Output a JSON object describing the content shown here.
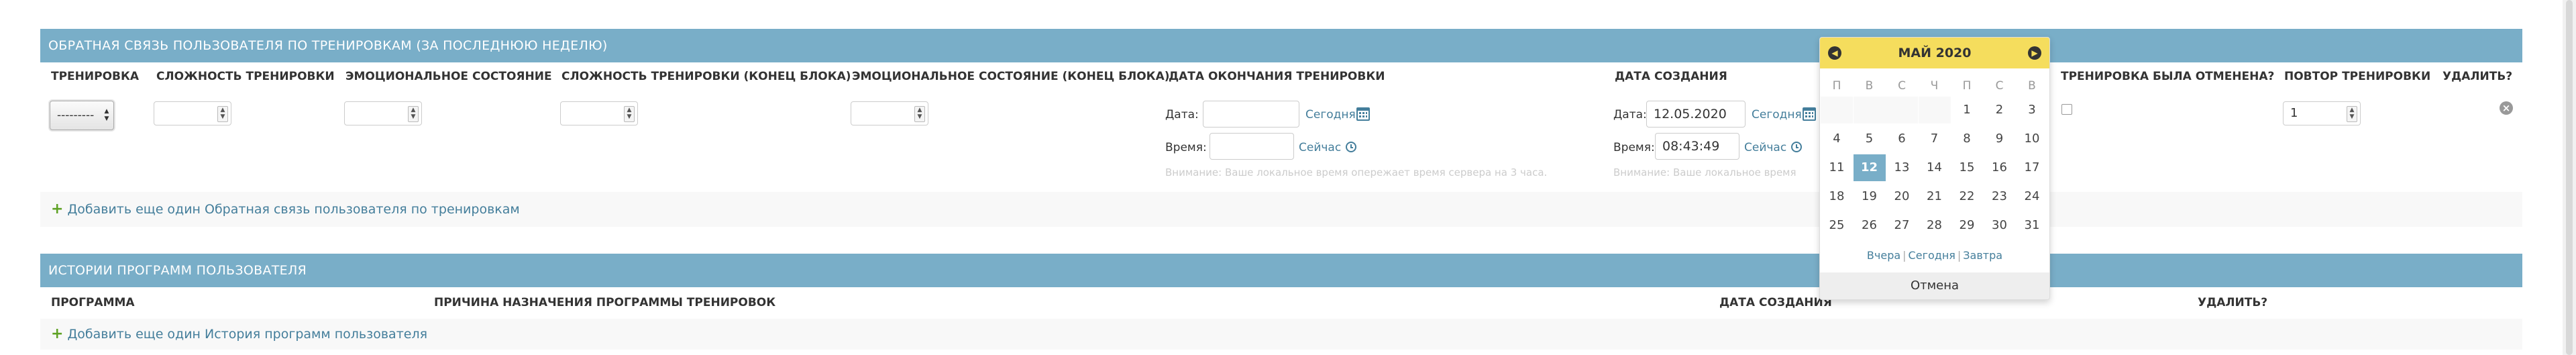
{
  "feedback": {
    "title": "ОБРАТНАЯ СВЯЗЬ ПОЛЬЗОВАТЕЛЯ ПО ТРЕНИРОВКАМ (ЗА ПОСЛЕДНЮЮ НЕДЕЛЮ)",
    "columns": {
      "training": "ТРЕНИРОВКА",
      "difficulty": "СЛОЖНОСТЬ ТРЕНИРОВКИ",
      "emotional": "ЭМОЦИОНАЛЬНОЕ СОСТОЯНИЕ",
      "difficulty_end": "СЛОЖНОСТЬ ТРЕНИРОВКИ (КОНЕЦ БЛОКА)",
      "emotional_end": "ЭМОЦИОНАЛЬНОЕ СОСТОЯНИЕ (КОНЕЦ БЛОКА)",
      "end_date": "ДАТА ОКОНЧАНИЯ ТРЕНИРОВКИ",
      "created": "ДАТА СОЗДАНИЯ",
      "cancelled": "ТРЕНИРОВКА БЫЛА ОТМЕНЕНА?",
      "repeat": "ПОВТОР ТРЕНИРОВКИ",
      "delete": "УДАЛИТЬ?"
    },
    "row": {
      "training_select": "---------",
      "difficulty_value": "",
      "emotional_value": "",
      "difficulty_end_value": "",
      "emotional_end_value": "",
      "end_date": {
        "date_label": "Дата:",
        "date_value": "",
        "today_link": "Сегодня",
        "time_label": "Время:",
        "time_value": "",
        "now_link": "Сейчас",
        "help_text": "Внимание: Ваше локальное время опережает время сервера на 3 часа."
      },
      "created": {
        "date_label": "Дата:",
        "date_value": "12.05.2020",
        "today_link": "Сегодня",
        "time_label": "Время:",
        "time_value": "08:43:49",
        "now_link": "Сейчас",
        "help_text": "Внимание: Ваше локальное время"
      },
      "repeat_value": "1",
      "delete_icon": "×"
    },
    "add_link": "Добавить еще один Обратная связь пользователя по тренировкам"
  },
  "history": {
    "title": "ИСТОРИИ ПРОГРАММ ПОЛЬЗОВАТЕЛЯ",
    "columns": {
      "program": "ПРОГРАММА",
      "reason": "ПРИЧИНА НАЗНАЧЕНИЯ ПРОГРАММЫ ТРЕНИРОВОК",
      "created": "ДАТА СОЗДАНИЯ",
      "delete": "УДАЛИТЬ?"
    },
    "add_link": "Добавить еще один История программ пользователя"
  },
  "calendar": {
    "caption": "МАЙ 2020",
    "prev_icon": "chevron-left-icon",
    "next_icon": "chevron-right-icon",
    "weekdays": [
      "П",
      "В",
      "С",
      "Ч",
      "П",
      "С",
      "В"
    ],
    "selected_day": "12",
    "shortcut_yesterday": "Вчера",
    "shortcut_today": "Сегодня",
    "shortcut_tomorrow": "Завтра",
    "shortcut_sep": "|",
    "cancel": "Отмена"
  },
  "colors": {
    "module_header": "#79aec8",
    "link": "#447e9b",
    "calendar_caption": "#f5dd5d",
    "add_plus": "#5fa225"
  }
}
